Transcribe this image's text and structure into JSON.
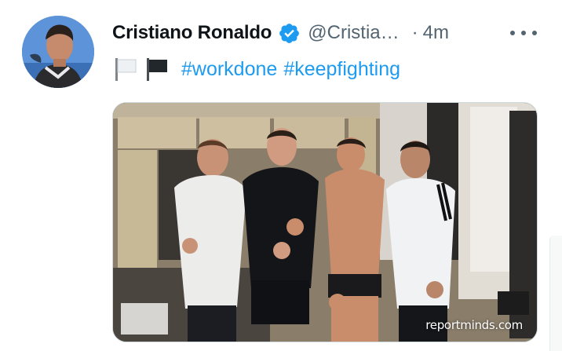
{
  "tweet": {
    "author": {
      "display_name": "Cristiano Ronaldo",
      "handle": "@Cristia…",
      "verified": true
    },
    "separator": "·",
    "time": "4m",
    "flags": [
      "white-flag",
      "black-flag"
    ],
    "hashtags": [
      "#workdone",
      "#keepfighting"
    ],
    "media": {
      "watermark": "reportminds.com"
    }
  },
  "colors": {
    "accent": "#1d9bf0",
    "text_primary": "#0f1419",
    "text_secondary": "#536471"
  }
}
